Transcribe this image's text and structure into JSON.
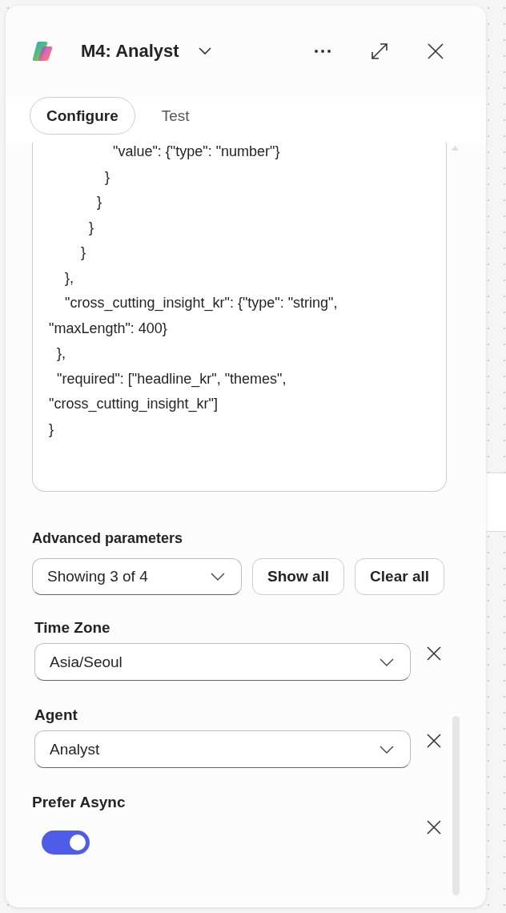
{
  "header": {
    "title": "M4: Analyst"
  },
  "tabs": [
    {
      "label": "Configure",
      "selected": true
    },
    {
      "label": "Test",
      "selected": false
    }
  ],
  "code_lines": [
    "                \"value\": {\"type\": \"number\"}",
    "              }",
    "            }",
    "          }",
    "        }",
    "    },",
    "    \"cross_cutting_insight_kr\": {\"type\": \"string\", \"maxLength\": 400}",
    "  },",
    "  \"required\": [\"headline_kr\", \"themes\", \"cross_cutting_insight_kr\"]",
    "}"
  ],
  "advanced": {
    "label": "Advanced parameters",
    "filter": {
      "value": "Showing 3 of 4"
    },
    "buttons": [
      "Show all",
      "Clear all"
    ],
    "params": [
      {
        "kind": "dropdown",
        "label": "Time Zone",
        "value": "Asia/Seoul"
      },
      {
        "kind": "dropdown",
        "label": "Agent",
        "value": "Analyst"
      },
      {
        "kind": "toggle",
        "label": "Prefer Async",
        "on": true
      }
    ]
  }
}
